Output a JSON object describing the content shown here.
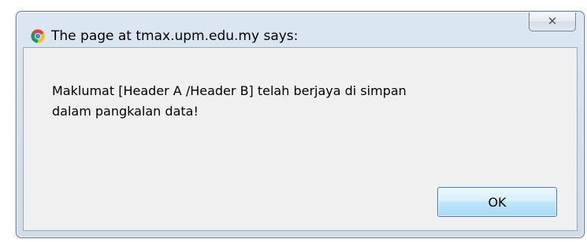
{
  "dialog": {
    "title": "The page at tmax.upm.edu.my says:",
    "title_icon": "chrome-icon",
    "close_icon": "close-icon",
    "message_line1": "Maklumat [Header A /Header B] telah berjaya di simpan",
    "message_line2": "dalam pangkalan data!",
    "ok_label": "OK"
  },
  "colors": {
    "frame": "#d4e1ee",
    "client_bg": "#f0f0f0",
    "ok_button_border": "#3c7fb1"
  }
}
